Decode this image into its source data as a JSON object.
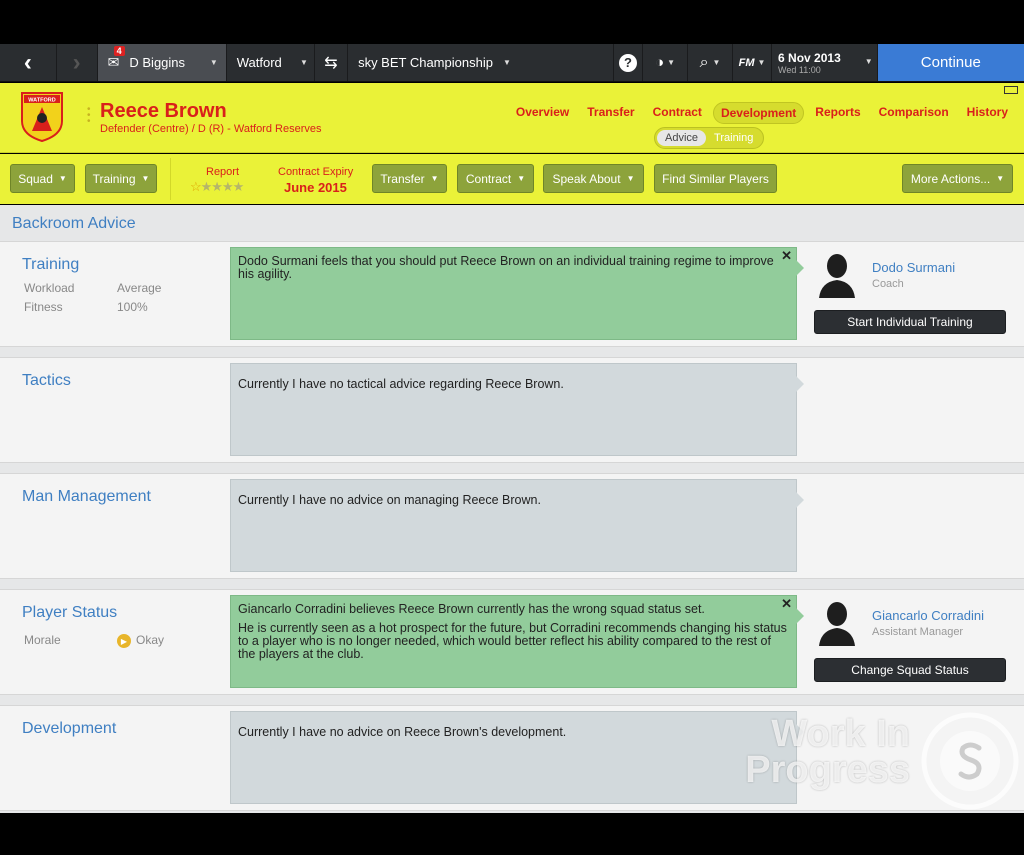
{
  "topbar": {
    "manager": "D Biggins",
    "inbox_count": "4",
    "team": "Watford",
    "league": "sky BET Championship",
    "fm_label": "FM",
    "date": "6 Nov 2013",
    "time": "Wed 11:00",
    "continue_label": "Continue"
  },
  "player": {
    "name": "Reece Brown",
    "position": "Defender (Centre) / D (R) - Watford Reserves",
    "club_crest_text": "WATFORD"
  },
  "nav": {
    "tabs": [
      "Overview",
      "Transfer",
      "Contract",
      "Development",
      "Reports",
      "Comparison",
      "History"
    ],
    "active_tab": "Development",
    "subtabs": [
      "Advice",
      "Training"
    ],
    "active_subtab": "Advice"
  },
  "actions": {
    "squad": "Squad",
    "training": "Training",
    "report_label": "Report",
    "report_stars": 0.5,
    "contract_expiry_label": "Contract Expiry",
    "contract_expiry_value": "June 2015",
    "transfer": "Transfer",
    "contract": "Contract",
    "speak_about": "Speak About",
    "find_similar": "Find Similar Players",
    "more_actions": "More Actions..."
  },
  "content": {
    "section_title": "Backroom Advice",
    "training": {
      "title": "Training",
      "workload_label": "Workload",
      "workload_value": "Average",
      "fitness_label": "Fitness",
      "fitness_value": "100%",
      "advice": "Dodo Surmani feels that you should put Reece Brown on an individual training regime to improve his agility.",
      "staff_name": "Dodo Surmani",
      "staff_role": "Coach",
      "button": "Start Individual Training"
    },
    "tactics": {
      "title": "Tactics",
      "advice": "Currently I have no tactical advice regarding Reece Brown."
    },
    "man_management": {
      "title": "Man Management",
      "advice": "Currently I have no advice on managing Reece Brown."
    },
    "player_status": {
      "title": "Player Status",
      "morale_label": "Morale",
      "morale_value": "Okay",
      "advice_1": "Giancarlo Corradini believes Reece Brown currently has the wrong squad status set.",
      "advice_2": "He is currently seen as a hot prospect for the future, but Corradini recommends changing his status to a player who is no longer needed, which would better reflect his ability compared to the rest of the players at the club.",
      "staff_name": "Giancarlo Corradini",
      "staff_role": "Assistant Manager",
      "button": "Change Squad Status"
    },
    "development": {
      "title": "Development",
      "advice": "Currently I have no advice on Reece Brown's development."
    }
  },
  "watermark": {
    "line1": "Work In",
    "line2": "Progress",
    "logo_text": "SPORTS INTERACTIVE"
  }
}
